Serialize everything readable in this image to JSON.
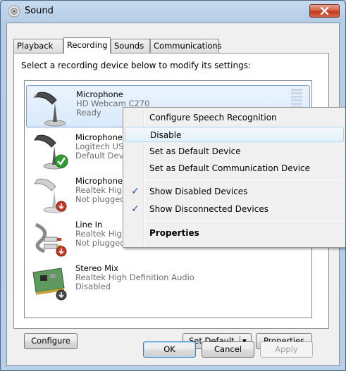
{
  "window": {
    "title": "Sound",
    "close_icon": "close-icon"
  },
  "tabs": [
    {
      "label": "Playback"
    },
    {
      "label": "Recording"
    },
    {
      "label": "Sounds"
    },
    {
      "label": "Communications"
    }
  ],
  "active_tab": "Recording",
  "instructions": "Select a recording device below to modify its settings:",
  "devices": [
    {
      "name": "Microphone",
      "line1": "HD Webcam C270",
      "line2": "Ready",
      "icon": "microphone-icon",
      "status_badge": "",
      "selected": true
    },
    {
      "name": "Microphone",
      "line1": "Logitech USB",
      "line2": "Default Device",
      "icon": "microphone-icon",
      "status_badge": "default-check-icon",
      "selected": false
    },
    {
      "name": "Microphone",
      "line1": "Realtek High Definition Audio",
      "line2": "Not plugged in",
      "icon": "microphone-icon",
      "status_badge": "unplugged-icon",
      "selected": false
    },
    {
      "name": "Line In",
      "line1": "Realtek High Definition Audio",
      "line2": "Not plugged in",
      "icon": "line-in-cable-icon",
      "status_badge": "unplugged-icon",
      "selected": false
    },
    {
      "name": "Stereo Mix",
      "line1": "Realtek High Definition Audio",
      "line2": "Disabled",
      "icon": "sound-card-icon",
      "status_badge": "disabled-icon",
      "selected": false
    }
  ],
  "buttons": {
    "configure": "Configure",
    "set_default": "Set Default",
    "properties": "Properties",
    "ok": "OK",
    "cancel": "Cancel",
    "apply": "Apply"
  },
  "context_menu": {
    "items": [
      {
        "label": "Configure Speech Recognition",
        "checked": false,
        "bold": false
      },
      {
        "label": "Disable",
        "checked": false,
        "bold": false,
        "hover": true
      },
      {
        "label": "Set as Default Device",
        "checked": false,
        "bold": false
      },
      {
        "label": "Set as Default Communication Device",
        "checked": false,
        "bold": false
      },
      {
        "label": "Show Disabled Devices",
        "checked": true,
        "bold": false
      },
      {
        "label": "Show Disconnected Devices",
        "checked": true,
        "bold": false
      },
      {
        "label": "Properties",
        "checked": false,
        "bold": true
      }
    ]
  },
  "colors": {
    "check": "#1d53a8",
    "selection": "#d9eafc",
    "close_button": "#c2381c"
  }
}
